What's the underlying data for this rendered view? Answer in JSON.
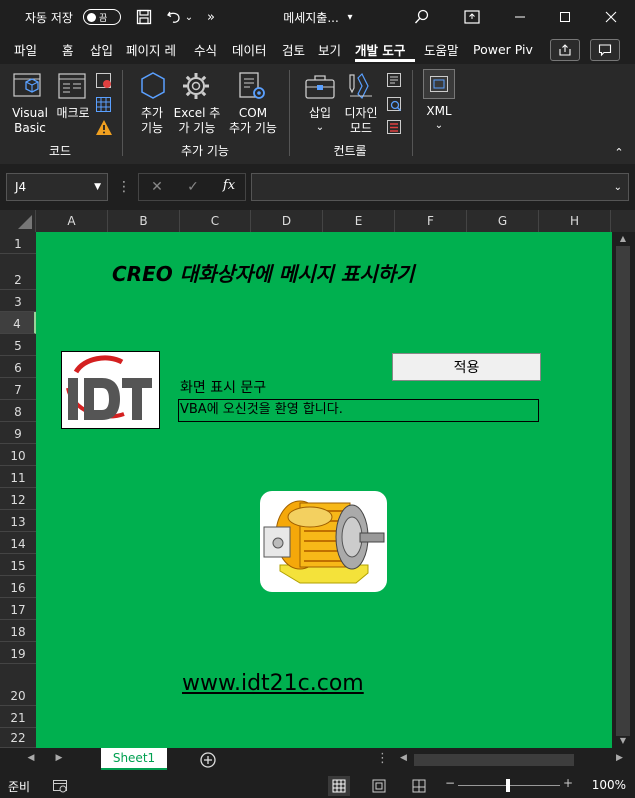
{
  "titlebar": {
    "autosave_label": "자동 저장",
    "autosave_state": "끔",
    "filename": "메세지출...",
    "buttons": [
      "minimize",
      "restore",
      "close"
    ]
  },
  "tabs": [
    {
      "label": "파일",
      "active": false
    },
    {
      "label": "홈",
      "active": false
    },
    {
      "label": "삽입",
      "active": false
    },
    {
      "label": "페이지 레",
      "active": false
    },
    {
      "label": "수식",
      "active": false
    },
    {
      "label": "데이터",
      "active": false
    },
    {
      "label": "검토",
      "active": false
    },
    {
      "label": "보기",
      "active": false
    },
    {
      "label": "개발 도구",
      "active": true
    },
    {
      "label": "도움말",
      "active": false
    },
    {
      "label": "Power Piv",
      "active": false
    }
  ],
  "ribbon": {
    "visual_basic": [
      "Visual",
      "Basic"
    ],
    "macro": "매크로",
    "group_code": "코드",
    "addins": [
      "추가",
      "기능"
    ],
    "excel_addins": [
      "Excel 추",
      "가 기능"
    ],
    "com_addins": [
      "COM",
      "추가 기능"
    ],
    "group_addins": "추가 기능",
    "insert": "삽입",
    "design_mode": [
      "디자인",
      "모드"
    ],
    "group_controls": "컨트롤",
    "xml": "XML"
  },
  "formula_bar": {
    "name_box": "J4",
    "fx": "fx",
    "value": ""
  },
  "columns": [
    "A",
    "B",
    "C",
    "D",
    "E",
    "F",
    "G",
    "H"
  ],
  "rows": [
    "1",
    "2",
    "3",
    "4",
    "5",
    "6",
    "7",
    "8",
    "9",
    "10",
    "11",
    "12",
    "13",
    "14",
    "15",
    "16",
    "17",
    "18",
    "19",
    "20",
    "21",
    "22"
  ],
  "selected_row": "4",
  "sheet": {
    "title": "CREO 대화상자에 메시지 표시하기",
    "logo_text": "IDT",
    "apply_button": "적용",
    "display_label": "화면 표시 문구",
    "display_value": "VBA에 오신것을 환영 합니다.",
    "website": "www.idt21c.com",
    "bg_color": "#00b04f"
  },
  "sheet_tabs": [
    "Sheet1"
  ],
  "status": {
    "ready": "준비",
    "zoom": "100%"
  }
}
